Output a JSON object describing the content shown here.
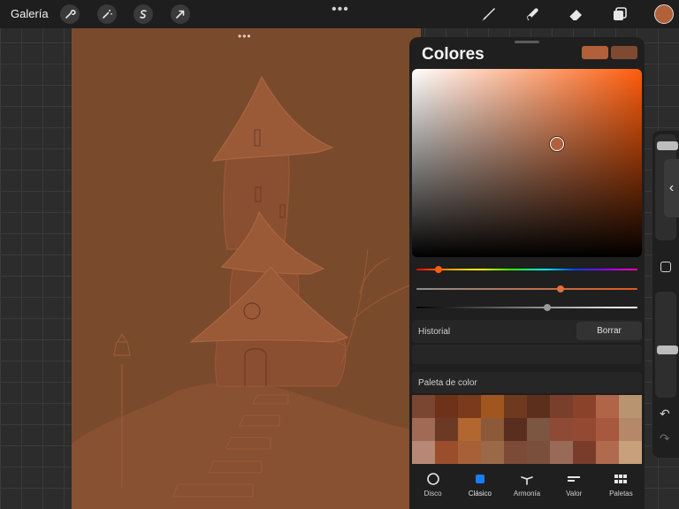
{
  "topbar": {
    "gallery_label": "Galería",
    "left_tools": [
      "wrench-icon",
      "magic-wand-icon",
      "selection-s-icon",
      "transform-arrow-icon"
    ],
    "center_more": "•••",
    "right_tools": [
      "brush-icon",
      "smudge-icon",
      "eraser-icon",
      "layers-icon"
    ],
    "current_color": "#b2603a"
  },
  "canvas": {
    "more": "•••",
    "background_color": "#7a4a2c"
  },
  "colors_panel": {
    "title": "Colores",
    "current_swatch": "#b2603a",
    "previous_swatch": "#7e4a32",
    "picker_hue_color": "#ff5c0b",
    "cursor": {
      "saturation": 0.63,
      "brightness": 0.6
    },
    "hue_position": 0.1,
    "saturation_slider_position": 0.65,
    "value_slider_position": 0.59,
    "history": {
      "label": "Historial",
      "clear_label": "Borrar"
    },
    "palette": {
      "label": "Paleta de color",
      "colors": [
        "#7a4632",
        "#6e3219",
        "#7a3a1c",
        "#a2561f",
        "#6e3a1e",
        "#5c2f1c",
        "#7a3f2c",
        "#8a432b",
        "#b06448",
        "#b89470",
        "#a06a55",
        "#6c3a24",
        "#b26630",
        "#8c5a38",
        "#5a2e1e",
        "#7c5640",
        "#8e4a34",
        "#944a32",
        "#a8583e",
        "#b6886a",
        "#b88876",
        "#9a4e2c",
        "#a86038",
        "#9a6a48",
        "#7c4a36",
        "#7a4f3c",
        "#9a6a58",
        "#7a3c2a",
        "#b06a4e",
        "#c8a07a"
      ]
    },
    "tabs": [
      {
        "label": "Disco",
        "icon": "disc-icon"
      },
      {
        "label": "Clásico",
        "icon": "classic-square-icon",
        "active": true
      },
      {
        "label": "Armonía",
        "icon": "harmony-icon"
      },
      {
        "label": "Valor",
        "icon": "value-sliders-icon"
      },
      {
        "label": "Paletas",
        "icon": "palettes-grid-icon"
      }
    ]
  },
  "sidebar": {
    "brush_size_level": 0.93,
    "opacity_level": 0.45,
    "undo_icon": "undo-icon",
    "redo_icon": "redo-icon"
  }
}
